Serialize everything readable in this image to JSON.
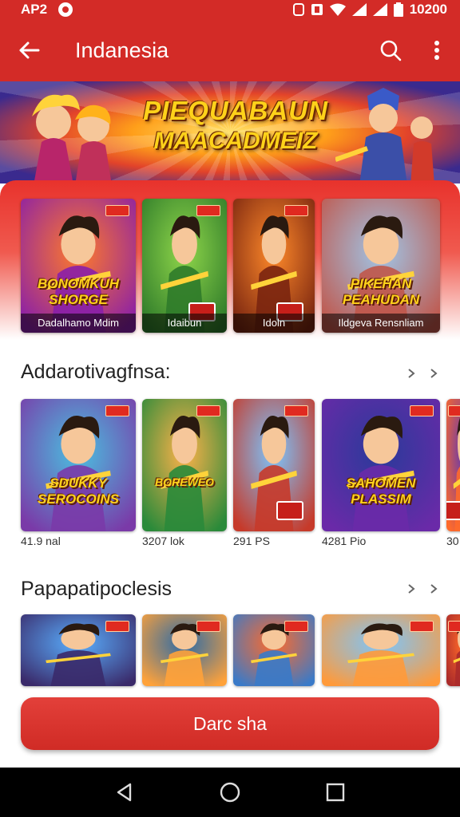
{
  "status_bar": {
    "left_text": "AP2",
    "time": "10200"
  },
  "app_bar": {
    "title": "Indanesia"
  },
  "hero": {
    "line1": "PIEQUABAUN",
    "line2": "MAACADMEIZ"
  },
  "featured": [
    {
      "logo": "BONOMKUH SHORGE",
      "caption": "Dadalhamo Mdim",
      "badge": "NEW",
      "colors": [
        "#ff7a2a",
        "#8a1fa8"
      ]
    },
    {
      "logo": "",
      "caption": "Idaibun",
      "badge": "NEW",
      "colors": [
        "#8fd64a",
        "#2f7b2a"
      ]
    },
    {
      "logo": "",
      "caption": "Idoln",
      "badge": "NEW",
      "colors": [
        "#ff8a2a",
        "#7a2510"
      ]
    },
    {
      "logo": "PIKEHAN PEAHUDAN",
      "caption": "Ildgeva Rensnliam",
      "badge": "",
      "colors": [
        "#9fc6e8",
        "#c0564a"
      ]
    }
  ],
  "sections": [
    {
      "title": "Addarotivagfnsa:",
      "items": [
        {
          "logo": "SDUKKY SEROCOINS",
          "meta": "41.9 nal",
          "colors": [
            "#4ac0e0",
            "#7a3aa8"
          ]
        },
        {
          "logo": "BOREWEO",
          "meta": "3207 lok",
          "colors": [
            "#ffb24a",
            "#2a8a3a"
          ]
        },
        {
          "logo": "",
          "meta": "291 PS",
          "colors": [
            "#7ac6ff",
            "#c63a2a"
          ]
        },
        {
          "logo": "SAHOMEN PLASSIM",
          "meta": "4281 Pio",
          "colors": [
            "#2a3a9a",
            "#6a2aa8"
          ]
        },
        {
          "logo": "",
          "meta": "30",
          "colors": [
            "#6a3aa8",
            "#ff6a2a"
          ]
        }
      ]
    },
    {
      "title": "Papapatipoclesis",
      "items": [
        {
          "colors": [
            "#5ab0ff",
            "#3a2a6a"
          ]
        },
        {
          "colors": [
            "#2a6aa8",
            "#ffa23a"
          ]
        },
        {
          "colors": [
            "#ff6a2a",
            "#3a7ac8"
          ]
        },
        {
          "colors": [
            "#7ac6ff",
            "#ff9a3a"
          ]
        },
        {
          "colors": [
            "#ff6a2a",
            "#aa2a2a"
          ]
        }
      ]
    }
  ],
  "cta": {
    "label": "Darc sha"
  }
}
